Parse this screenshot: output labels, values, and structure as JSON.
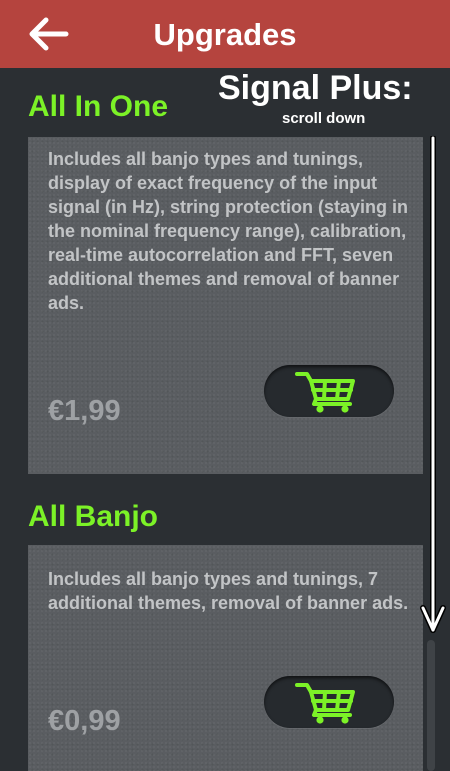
{
  "header": {
    "title": "Upgrades",
    "back_icon": "arrow-left-icon",
    "background_color": "#b5443e"
  },
  "annotation": {
    "title": "Signal Plus:",
    "subtitle": "scroll down"
  },
  "products": [
    {
      "title": "All In One",
      "description": "Includes all banjo types and tunings, display of exact frequency of the input signal (in Hz), string protection (staying in the nominal frequency range), calibration, real-time autocorrelation and FFT, seven additional themes and removal of banner ads.",
      "price": "€1,99",
      "buy_icon": "shopping-cart-icon"
    },
    {
      "title": "All Banjo",
      "description": "Includes all banjo types and tunings, 7 additional themes, removal of banner ads.",
      "price": "€0,99",
      "buy_icon": "shopping-cart-icon"
    }
  ],
  "colors": {
    "accent_green": "#7cf227",
    "background": "#2b2f33",
    "card": "#5a5d61"
  }
}
